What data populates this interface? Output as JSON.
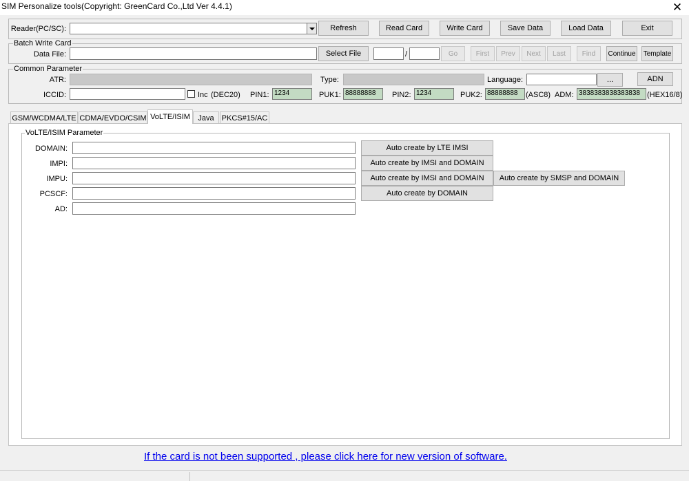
{
  "window": {
    "title": "SIM Personalize tools(Copyright: GreenCard Co.,Ltd Ver 4.4.1)",
    "close_glyph": "✕"
  },
  "toolbar": {
    "reader_label": "Reader(PC/SC):",
    "reader_value": "",
    "refresh": "Refresh",
    "read_card": "Read Card",
    "write_card": "Write Card",
    "save_data": "Save Data",
    "load_data": "Load Data",
    "exit": "Exit"
  },
  "batch": {
    "legend": "Batch Write Card",
    "data_file_label": "Data File:",
    "data_file_value": "",
    "select_file": "Select File",
    "page_current": "",
    "page_sep": "/",
    "page_total": "",
    "go": "Go",
    "first": "First",
    "prev": "Prev",
    "next": "Next",
    "last": "Last",
    "find": "Find",
    "continue": "Continue",
    "template": "Template"
  },
  "common": {
    "legend": "Common Parameter",
    "atr_label": "ATR:",
    "atr_value": "",
    "type_label": "Type:",
    "type_value": "",
    "language_label": "Language:",
    "language_value": "",
    "browse": "...",
    "adn": "ADN",
    "iccid_label": "ICCID:",
    "iccid_value": "",
    "inc_label": "Inc",
    "dec20": "(DEC20)",
    "pin1_label": "PIN1:",
    "pin1_value": "1234",
    "puk1_label": "PUK1:",
    "puk1_value": "88888888",
    "pin2_label": "PIN2:",
    "pin2_value": "1234",
    "puk2_label": "PUK2:",
    "puk2_value": "88888888",
    "asc8": "(ASC8)",
    "adm_label": "ADM:",
    "adm_value": "3838383838383838",
    "hex16": "(HEX16/8)"
  },
  "tabs": [
    "GSM/WCDMA/LTE",
    "CDMA/EVDO/CSIM",
    "VoLTE/ISIM",
    "Java",
    "PKCS#15/AC"
  ],
  "volte": {
    "legend": "VoLTE/ISIM  Parameter",
    "domain_label": "DOMAIN:",
    "domain_value": "",
    "impi_label": "IMPI:",
    "impi_value": "",
    "impu_label": "IMPU:",
    "impu_value": "",
    "pcscf_label": "PCSCF:",
    "pcscf_value": "",
    "ad_label": "AD:",
    "ad_value": "",
    "btn_lte_imsi": "Auto create by LTE IMSI",
    "btn_imsi_domain_1": "Auto create by IMSI and DOMAIN",
    "btn_imsi_domain_2": "Auto create by IMSI and DOMAIN",
    "btn_smsp_domain": "Auto create by SMSP and DOMAIN",
    "btn_domain": "Auto create by DOMAIN"
  },
  "footer": {
    "link": "If the card is not been supported , please click here for new version of software."
  }
}
